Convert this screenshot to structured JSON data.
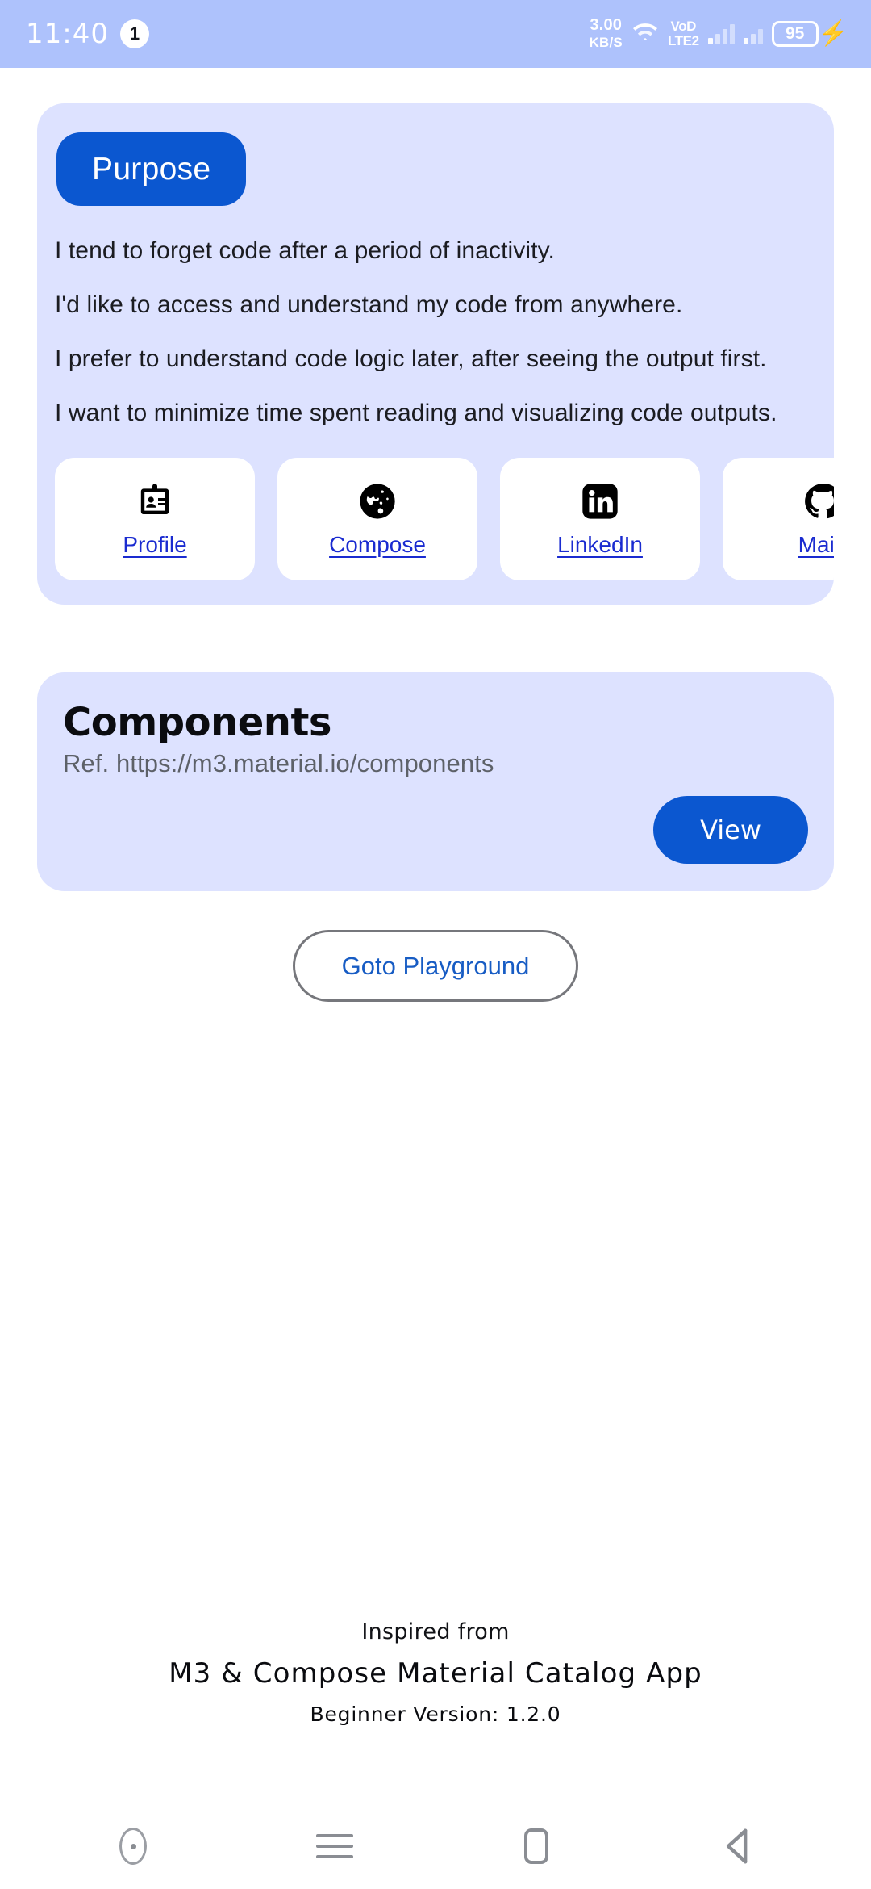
{
  "status_bar": {
    "clock": "11:40",
    "notification_count": "1",
    "net_speed_value": "3.00",
    "net_speed_unit": "KB/S",
    "wifi_icon": "wifi-icon",
    "volte_line1": "VoD",
    "volte_line2": "LTE2",
    "battery_percent": "95",
    "charging_icon": "lightning-bolt-icon",
    "bg_color": "#AEC2FC"
  },
  "purpose_card": {
    "chip_label": "Purpose",
    "bg_color": "#DDE2FF",
    "accent_color": "#0B57D0",
    "paragraphs": [
      "I tend to forget code after a period of inactivity.",
      "I'd like to access and understand my code from anywhere.",
      "I prefer to understand code logic later, after seeing the output first.",
      "I want to minimize time spent reading and visualizing code outputs."
    ],
    "links": [
      {
        "label": "Profile",
        "icon": "id-badge-icon"
      },
      {
        "label": "Compose",
        "icon": "globe-icon"
      },
      {
        "label": "LinkedIn",
        "icon": "linkedin-icon"
      },
      {
        "label": "Main",
        "icon": "github-icon"
      }
    ]
  },
  "components_card": {
    "title": "Components",
    "reference": "Ref. https://m3.material.io/components",
    "view_label": "View",
    "bg_color": "#DDE2FF"
  },
  "playground": {
    "label": "Goto Playground"
  },
  "footer": {
    "inspired_label": "Inspired from",
    "app_name": "M3 & Compose Material Catalog App",
    "version": "Beginner Version: 1.2.0"
  },
  "nav_bar": {
    "assistant_icon": "assistant-circle-icon",
    "recents_icon": "recents-menu-icon",
    "home_icon": "home-square-icon",
    "back_icon": "back-triangle-icon"
  }
}
